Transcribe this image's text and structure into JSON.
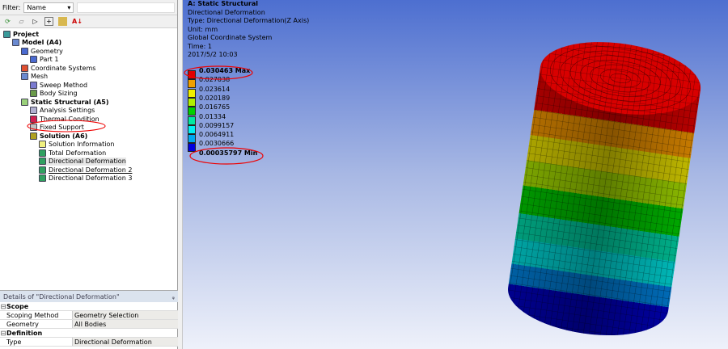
{
  "filter": {
    "label": "Filter:",
    "value": "Name",
    "text": ""
  },
  "toolbar": [
    "refresh-icon",
    "expand-icon",
    "suppress-icon",
    "plus-icon",
    "folder-icon",
    "sort-az-icon"
  ],
  "tree": [
    {
      "label": "Project",
      "bold": true,
      "level": 0
    },
    {
      "label": "Model (A4)",
      "bold": true,
      "level": 1
    },
    {
      "label": "Geometry",
      "level": 2
    },
    {
      "label": "Part 1",
      "level": 3
    },
    {
      "label": "Coordinate Systems",
      "level": 2
    },
    {
      "label": "Mesh",
      "level": 2
    },
    {
      "label": "Sweep Method",
      "level": 3
    },
    {
      "label": "Body Sizing",
      "level": 3
    },
    {
      "label": "Static Structural (A5)",
      "bold": true,
      "level": 2
    },
    {
      "label": "Analysis Settings",
      "level": 3
    },
    {
      "label": "Thermal Condition",
      "level": 3
    },
    {
      "label": "Fixed Support",
      "level": 3
    },
    {
      "label": "Solution (A6)",
      "bold": true,
      "level": 3
    },
    {
      "label": "Solution Information",
      "level": 4
    },
    {
      "label": "Total Deformation",
      "level": 4
    },
    {
      "label": "Directional Deformation",
      "level": 4,
      "selected": true
    },
    {
      "label": "Directional Deformation 2",
      "level": 4,
      "underline": true
    },
    {
      "label": "Directional Deformation 3",
      "level": 4
    }
  ],
  "details": {
    "title": "Details of \"Directional Deformation\"",
    "pin": "ᵩ",
    "groups": [
      {
        "name": "Scope",
        "rows": [
          [
            "Scoping Method",
            "Geometry Selection"
          ],
          [
            "Geometry",
            "All Bodies"
          ]
        ]
      },
      {
        "name": "Definition",
        "rows": [
          [
            "Type",
            "Directional Deformation"
          ]
        ]
      }
    ]
  },
  "viewport": {
    "title": "A: Static Structural",
    "lines": [
      "Directional Deformation",
      "Type: Directional Deformation(Z Axis)",
      "Unit: mm",
      "Global Coordinate System",
      "Time: 1",
      "2017/5/2 10:03"
    ],
    "legend": [
      "0.030463 Max",
      "0.027038",
      "0.023614",
      "0.020189",
      "0.016765",
      "0.01334",
      "0.0099157",
      "0.0064911",
      "0.0030666",
      "0.00035797 Min"
    ],
    "colors": [
      "#e00000",
      "#f0a000",
      "#f0f000",
      "#b0f000",
      "#00d000",
      "#00e8a0",
      "#00f0f0",
      "#00a8f0",
      "#0000e0"
    ]
  }
}
